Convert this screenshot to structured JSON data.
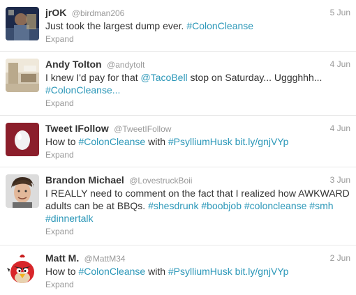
{
  "tweets": [
    {
      "name": "jrOK",
      "handle": "@birdman206",
      "time": "5 Jun",
      "text": [
        {
          "t": "Just took the largest dump ever. ",
          "link": false
        },
        {
          "t": "#ColonCleanse",
          "link": true
        }
      ],
      "expand": "Expand",
      "avatar": "avatar-photo-dark-person"
    },
    {
      "name": "Andy Tolton",
      "handle": "@andytolt",
      "time": "4 Jun",
      "text": [
        {
          "t": "I knew I'd pay for that ",
          "link": false
        },
        {
          "t": "@TacoBell",
          "link": true
        },
        {
          "t": " stop on Saturday... Uggghhh... ",
          "link": false
        },
        {
          "t": "#ColonCleanse...",
          "link": true
        }
      ],
      "expand": "Expand",
      "avatar": "avatar-photo-room"
    },
    {
      "name": "Tweet IFollow",
      "handle": "@TweetIFollow",
      "time": "4 Jun",
      "text": [
        {
          "t": "How to ",
          "link": false
        },
        {
          "t": "#ColonCleanse",
          "link": true
        },
        {
          "t": " with ",
          "link": false
        },
        {
          "t": "#PsylliumHusk",
          "link": true
        },
        {
          "t": " ",
          "link": false
        },
        {
          "t": "bit.ly/gnjVYp",
          "link": true
        }
      ],
      "expand": "Expand",
      "avatar": "egg-icon"
    },
    {
      "name": "Brandon Michael",
      "handle": "@LovestruckBoii",
      "time": "3 Jun",
      "text": [
        {
          "t": "I REALLY need to comment on the fact that I realized how AWKWARD adults can be at BBQs. ",
          "link": false
        },
        {
          "t": "#shesdrunk",
          "link": true
        },
        {
          "t": " ",
          "link": false
        },
        {
          "t": "#boobjob",
          "link": true
        },
        {
          "t": " ",
          "link": false
        },
        {
          "t": "#coloncleanse",
          "link": true
        },
        {
          "t": " ",
          "link": false
        },
        {
          "t": "#smh",
          "link": true
        },
        {
          "t": " ",
          "link": false
        },
        {
          "t": "#dinnertalk",
          "link": true
        }
      ],
      "expand": "Expand",
      "avatar": "avatar-photo-young-man"
    },
    {
      "name": "Matt M.",
      "handle": "@MattM34",
      "time": "2 Jun",
      "text": [
        {
          "t": "How to ",
          "link": false
        },
        {
          "t": "#ColonCleanse",
          "link": true
        },
        {
          "t": " with ",
          "link": false
        },
        {
          "t": "#PsylliumHusk",
          "link": true
        },
        {
          "t": " ",
          "link": false
        },
        {
          "t": "bit.ly/gnjVYp",
          "link": true
        }
      ],
      "expand": "Expand",
      "avatar": "angry-bird-icon"
    }
  ],
  "colors": {
    "link": "#2b97b8",
    "name": "#333333",
    "meta": "#999999",
    "divider": "#e8e8e8"
  }
}
